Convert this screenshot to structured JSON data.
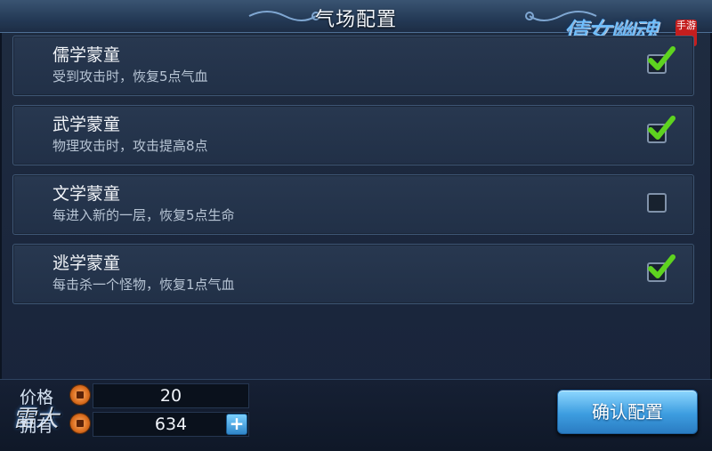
{
  "window": {
    "title": "气场配置"
  },
  "logo": {
    "text": "倩女幽魂",
    "badge": "手游"
  },
  "items": [
    {
      "name": "儒学蒙童",
      "desc": "受到攻击时，恢复5点气血",
      "checked": true
    },
    {
      "name": "武学蒙童",
      "desc": "物理攻击时，攻击提高8点",
      "checked": true
    },
    {
      "name": "文学蒙童",
      "desc": "每进入新的一层，恢复5点生命",
      "checked": false
    },
    {
      "name": "逃学蒙童",
      "desc": "每击杀一个怪物，恢复1点气血",
      "checked": true
    }
  ],
  "footer": {
    "price_label": "价格",
    "price_value": "20",
    "owned_label": "拥有",
    "owned_value": "634",
    "plus_label": "+",
    "confirm_label": "确认配置",
    "seal_text": "雷大"
  },
  "colors": {
    "accent": "#3d9de0",
    "check": "#4caf1a",
    "coin": "#d96b1c"
  }
}
